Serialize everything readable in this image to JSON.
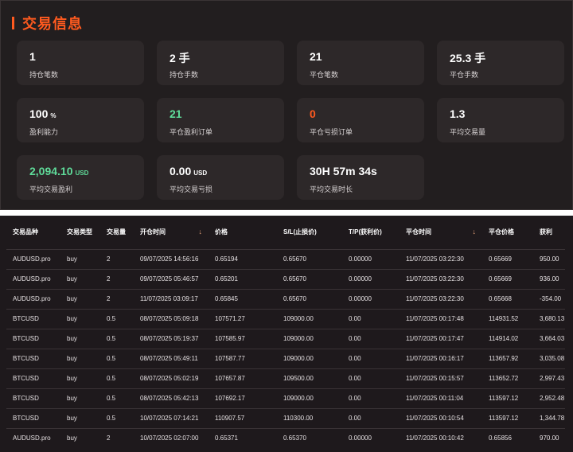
{
  "section_title": "交易信息",
  "stats": [
    {
      "value": "1",
      "unit": "",
      "label": "持仓笔数",
      "color": "white"
    },
    {
      "value": "2 手",
      "unit": "",
      "label": "持仓手数",
      "color": "white"
    },
    {
      "value": "21",
      "unit": "",
      "label": "平仓笔数",
      "color": "white"
    },
    {
      "value": "25.3 手",
      "unit": "",
      "label": "平仓手数",
      "color": "white"
    },
    {
      "value": "100",
      "unit": "%",
      "label": "盈利能力",
      "color": "white"
    },
    {
      "value": "21",
      "unit": "",
      "label": "平仓盈利订单",
      "color": "green"
    },
    {
      "value": "0",
      "unit": "",
      "label": "平仓亏损订单",
      "color": "orange"
    },
    {
      "value": "1.3",
      "unit": "",
      "label": "平均交易量",
      "color": "white"
    },
    {
      "value": "2,094.10",
      "unit": "USD",
      "label": "平均交易盈利",
      "color": "green"
    },
    {
      "value": "0.00",
      "unit": "USD",
      "label": "平均交易亏损",
      "color": "white"
    },
    {
      "value": "30H 57m 34s",
      "unit": "",
      "label": "平均交易时长",
      "color": "white"
    }
  ],
  "table": {
    "headers": [
      "交易品种",
      "交易类型",
      "交易量",
      "开仓时间",
      "价格",
      "S/L(止损价)",
      "T/P(获利价)",
      "平仓时间",
      "平仓价格",
      "获利"
    ],
    "rows": [
      [
        "AUDUSD.pro",
        "buy",
        "2",
        "09/07/2025 14:56:16",
        "0.65194",
        "0.65670",
        "0.00000",
        "11/07/2025 03:22:30",
        "0.65669",
        "950.00"
      ],
      [
        "AUDUSD.pro",
        "buy",
        "2",
        "09/07/2025 05:46:57",
        "0.65201",
        "0.65670",
        "0.00000",
        "11/07/2025 03:22:30",
        "0.65669",
        "936.00"
      ],
      [
        "AUDUSD.pro",
        "buy",
        "2",
        "11/07/2025 03:09:17",
        "0.65845",
        "0.65670",
        "0.00000",
        "11/07/2025 03:22:30",
        "0.65668",
        "-354.00"
      ],
      [
        "BTCUSD",
        "buy",
        "0.5",
        "08/07/2025 05:09:18",
        "107571.27",
        "109000.00",
        "0.00",
        "11/07/2025 00:17:48",
        "114931.52",
        "3,680.13"
      ],
      [
        "BTCUSD",
        "buy",
        "0.5",
        "08/07/2025 05:19:37",
        "107585.97",
        "109000.00",
        "0.00",
        "11/07/2025 00:17:47",
        "114914.02",
        "3,664.03"
      ],
      [
        "BTCUSD",
        "buy",
        "0.5",
        "08/07/2025 05:49:11",
        "107587.77",
        "109000.00",
        "0.00",
        "11/07/2025 00:16:17",
        "113657.92",
        "3,035.08"
      ],
      [
        "BTCUSD",
        "buy",
        "0.5",
        "08/07/2025 05:02:19",
        "107657.87",
        "109500.00",
        "0.00",
        "11/07/2025 00:15:57",
        "113652.72",
        "2,997.43"
      ],
      [
        "BTCUSD",
        "buy",
        "0.5",
        "08/07/2025 05:42:13",
        "107692.17",
        "109000.00",
        "0.00",
        "11/07/2025 00:11:04",
        "113597.12",
        "2,952.48"
      ],
      [
        "BTCUSD",
        "buy",
        "0.5",
        "10/07/2025 07:14:21",
        "110907.57",
        "110300.00",
        "0.00",
        "11/07/2025 00:10:54",
        "113597.12",
        "1,344.78"
      ],
      [
        "AUDUSD.pro",
        "buy",
        "2",
        "10/07/2025 02:07:00",
        "0.65371",
        "0.65370",
        "0.00000",
        "11/07/2025 00:10:42",
        "0.65856",
        "970.00"
      ]
    ]
  },
  "colors": {
    "accent": "#ff5a1f",
    "profit_green": "#5fdc9a",
    "panel_bg": "#221e1f",
    "card_bg": "#2d2829",
    "table_bg": "#1e191c"
  },
  "sort_icon": "arrow-down-icon"
}
